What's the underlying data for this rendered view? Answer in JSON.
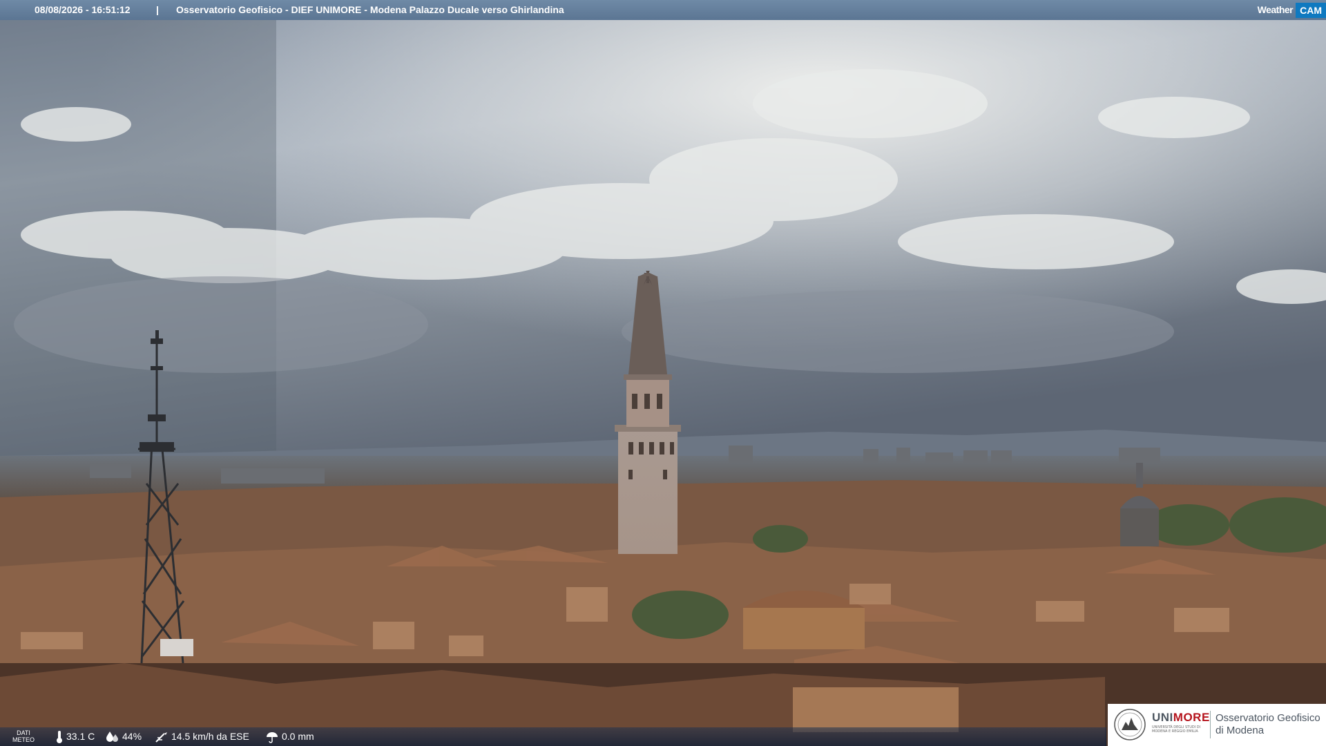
{
  "header": {
    "timestamp": "08/08/2026 - 16:51:12",
    "separator": "|",
    "title": "Osservatorio Geofisico - DIEF UNIMORE - Modena Palazzo Ducale verso Ghirlandina",
    "brand_weather": "Weather",
    "brand_cam": "CAM"
  },
  "weather_bar": {
    "label_line1": "DATI",
    "label_line2": "METEO",
    "temperature": "33.1 C",
    "humidity": "44%",
    "wind": "14.5 km/h da ESE",
    "rain": "0.0 mm"
  },
  "logo": {
    "uni_part1": "UNI",
    "uni_part2": "MORE",
    "uni_sub_line1": "UNIVERSITÀ DEGLI STUDI DI",
    "uni_sub_line2": "MODENA E REGGIO EMILIA",
    "obs_line1": "Osservatorio Geofisico",
    "obs_line2": "di Modena"
  },
  "colors": {
    "brand_blue": "#0f79c0",
    "unimore_red": "#b5121b",
    "header_bar": "#6580a0"
  }
}
